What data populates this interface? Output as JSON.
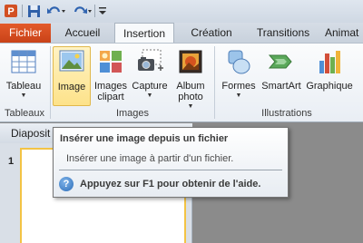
{
  "quick_access": {
    "app_icon": "powerpoint-icon",
    "save_icon": "save-icon",
    "undo_icon": "undo-icon",
    "redo_icon": "redo-icon",
    "customize_icon": "customize-toolbar-icon"
  },
  "tabs": [
    {
      "label": "Fichier"
    },
    {
      "label": "Accueil"
    },
    {
      "label": "Insertion"
    },
    {
      "label": "Création"
    },
    {
      "label": "Transitions"
    },
    {
      "label": "Animat"
    }
  ],
  "ribbon": {
    "groups": {
      "tableaux": "Tableaux",
      "images": "Images",
      "illustrations": "Illustrations"
    },
    "buttons": {
      "tableau": "Tableau",
      "image": "Image",
      "images_clipart_line1": "Images",
      "images_clipart_line2": "clipart",
      "capture": "Capture",
      "album_line1": "Album",
      "album_line2": "photo",
      "formes": "Formes",
      "smartart": "SmartArt",
      "graphique": "Graphique"
    }
  },
  "left_pane": {
    "header": "Diaposit",
    "slide_number": "1"
  },
  "tooltip": {
    "title": "Insérer une image depuis un fichier",
    "description": "Insérer une image à partir d'un fichier.",
    "help": "Appuyez sur F1 pour obtenir de l'aide."
  },
  "colors": {
    "file_tab": "#d24f22",
    "highlight": "#fde28a",
    "slide_border": "#f3c344"
  }
}
